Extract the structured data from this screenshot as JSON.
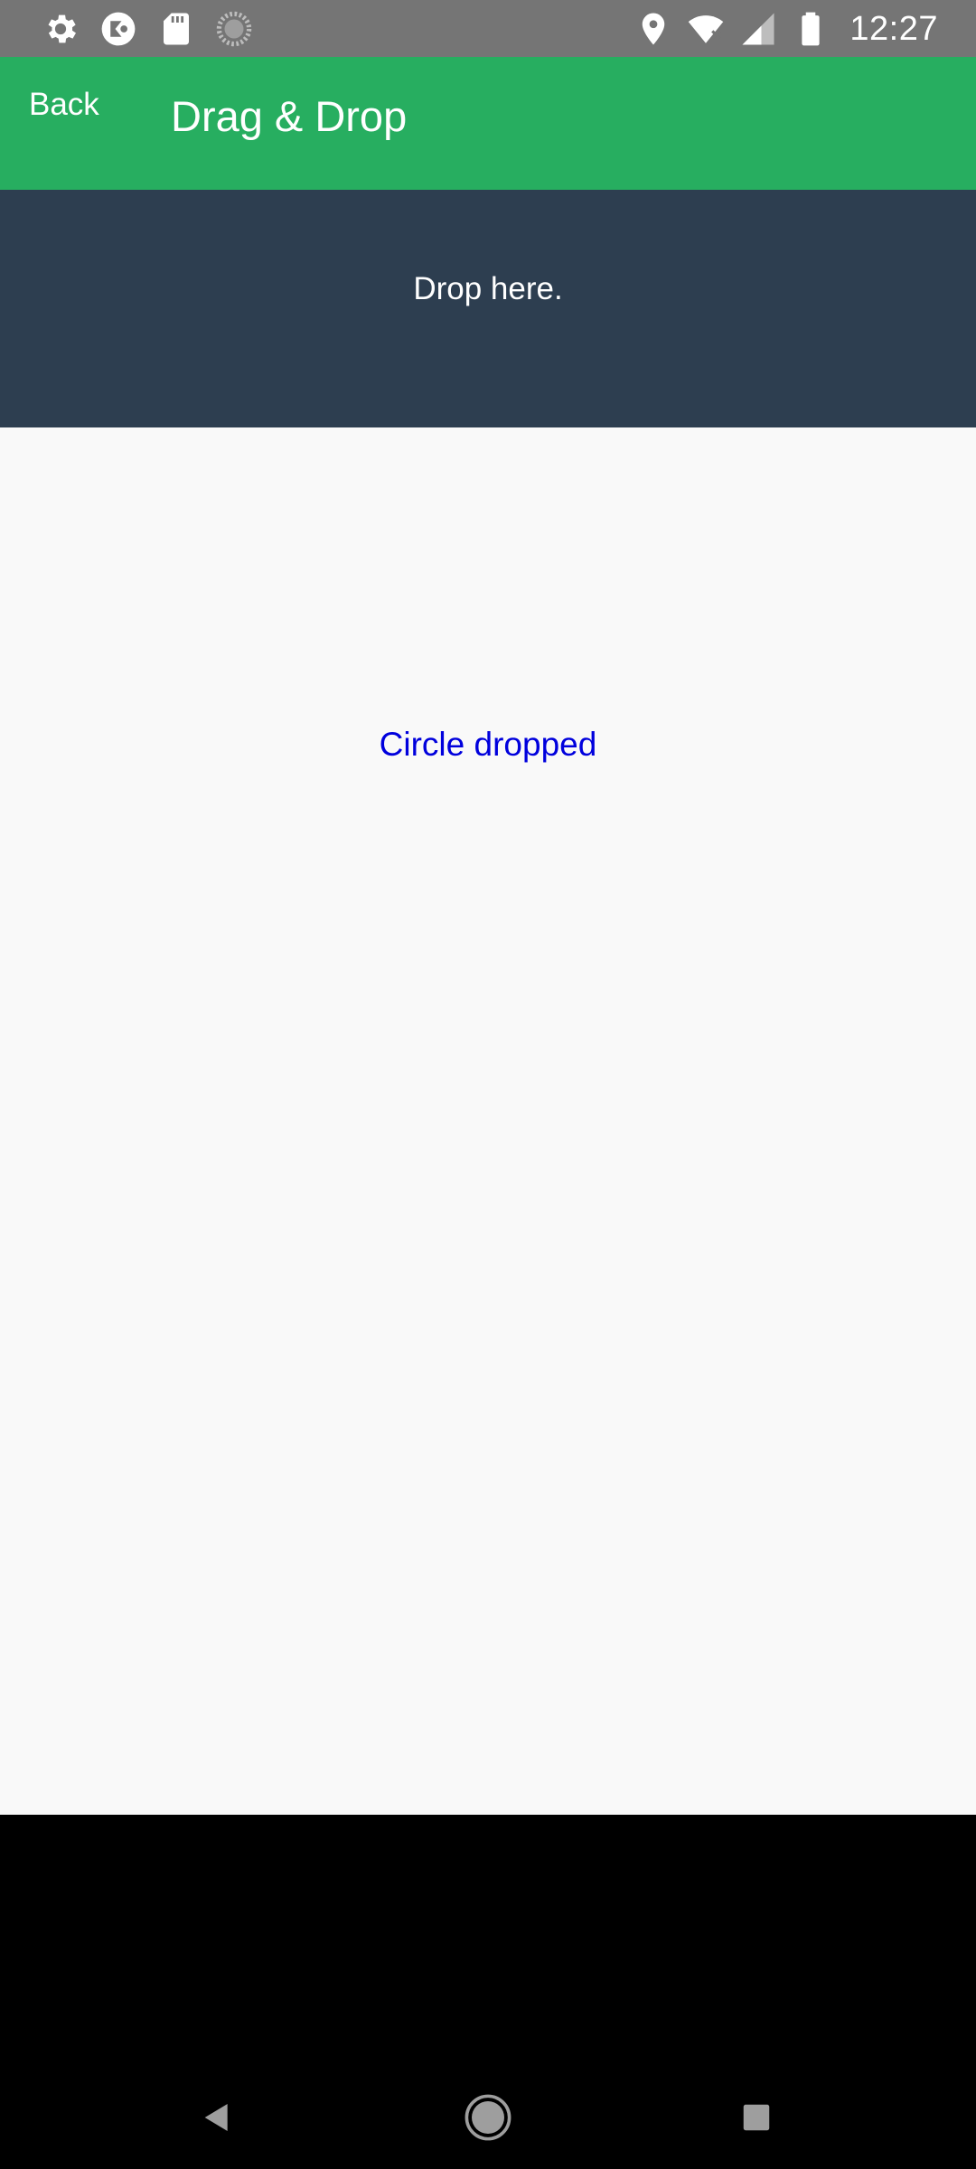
{
  "status_bar": {
    "left_icons": [
      "settings-icon",
      "app-icon",
      "sd-card-icon",
      "loading-icon"
    ],
    "right_icons": [
      "location-icon",
      "wifi-icon",
      "signal-icon",
      "battery-icon"
    ],
    "time": "12:27"
  },
  "app_bar": {
    "back_label": "Back",
    "title": "Drag & Drop",
    "color": "#27ae60"
  },
  "drop_zone": {
    "label": "Drop here.",
    "color": "#2d3e50"
  },
  "content": {
    "message": "Circle dropped",
    "message_color": "#0000dd"
  },
  "nav_bar": {
    "buttons": [
      "nav-back-icon",
      "nav-home-icon",
      "nav-recents-icon"
    ]
  }
}
